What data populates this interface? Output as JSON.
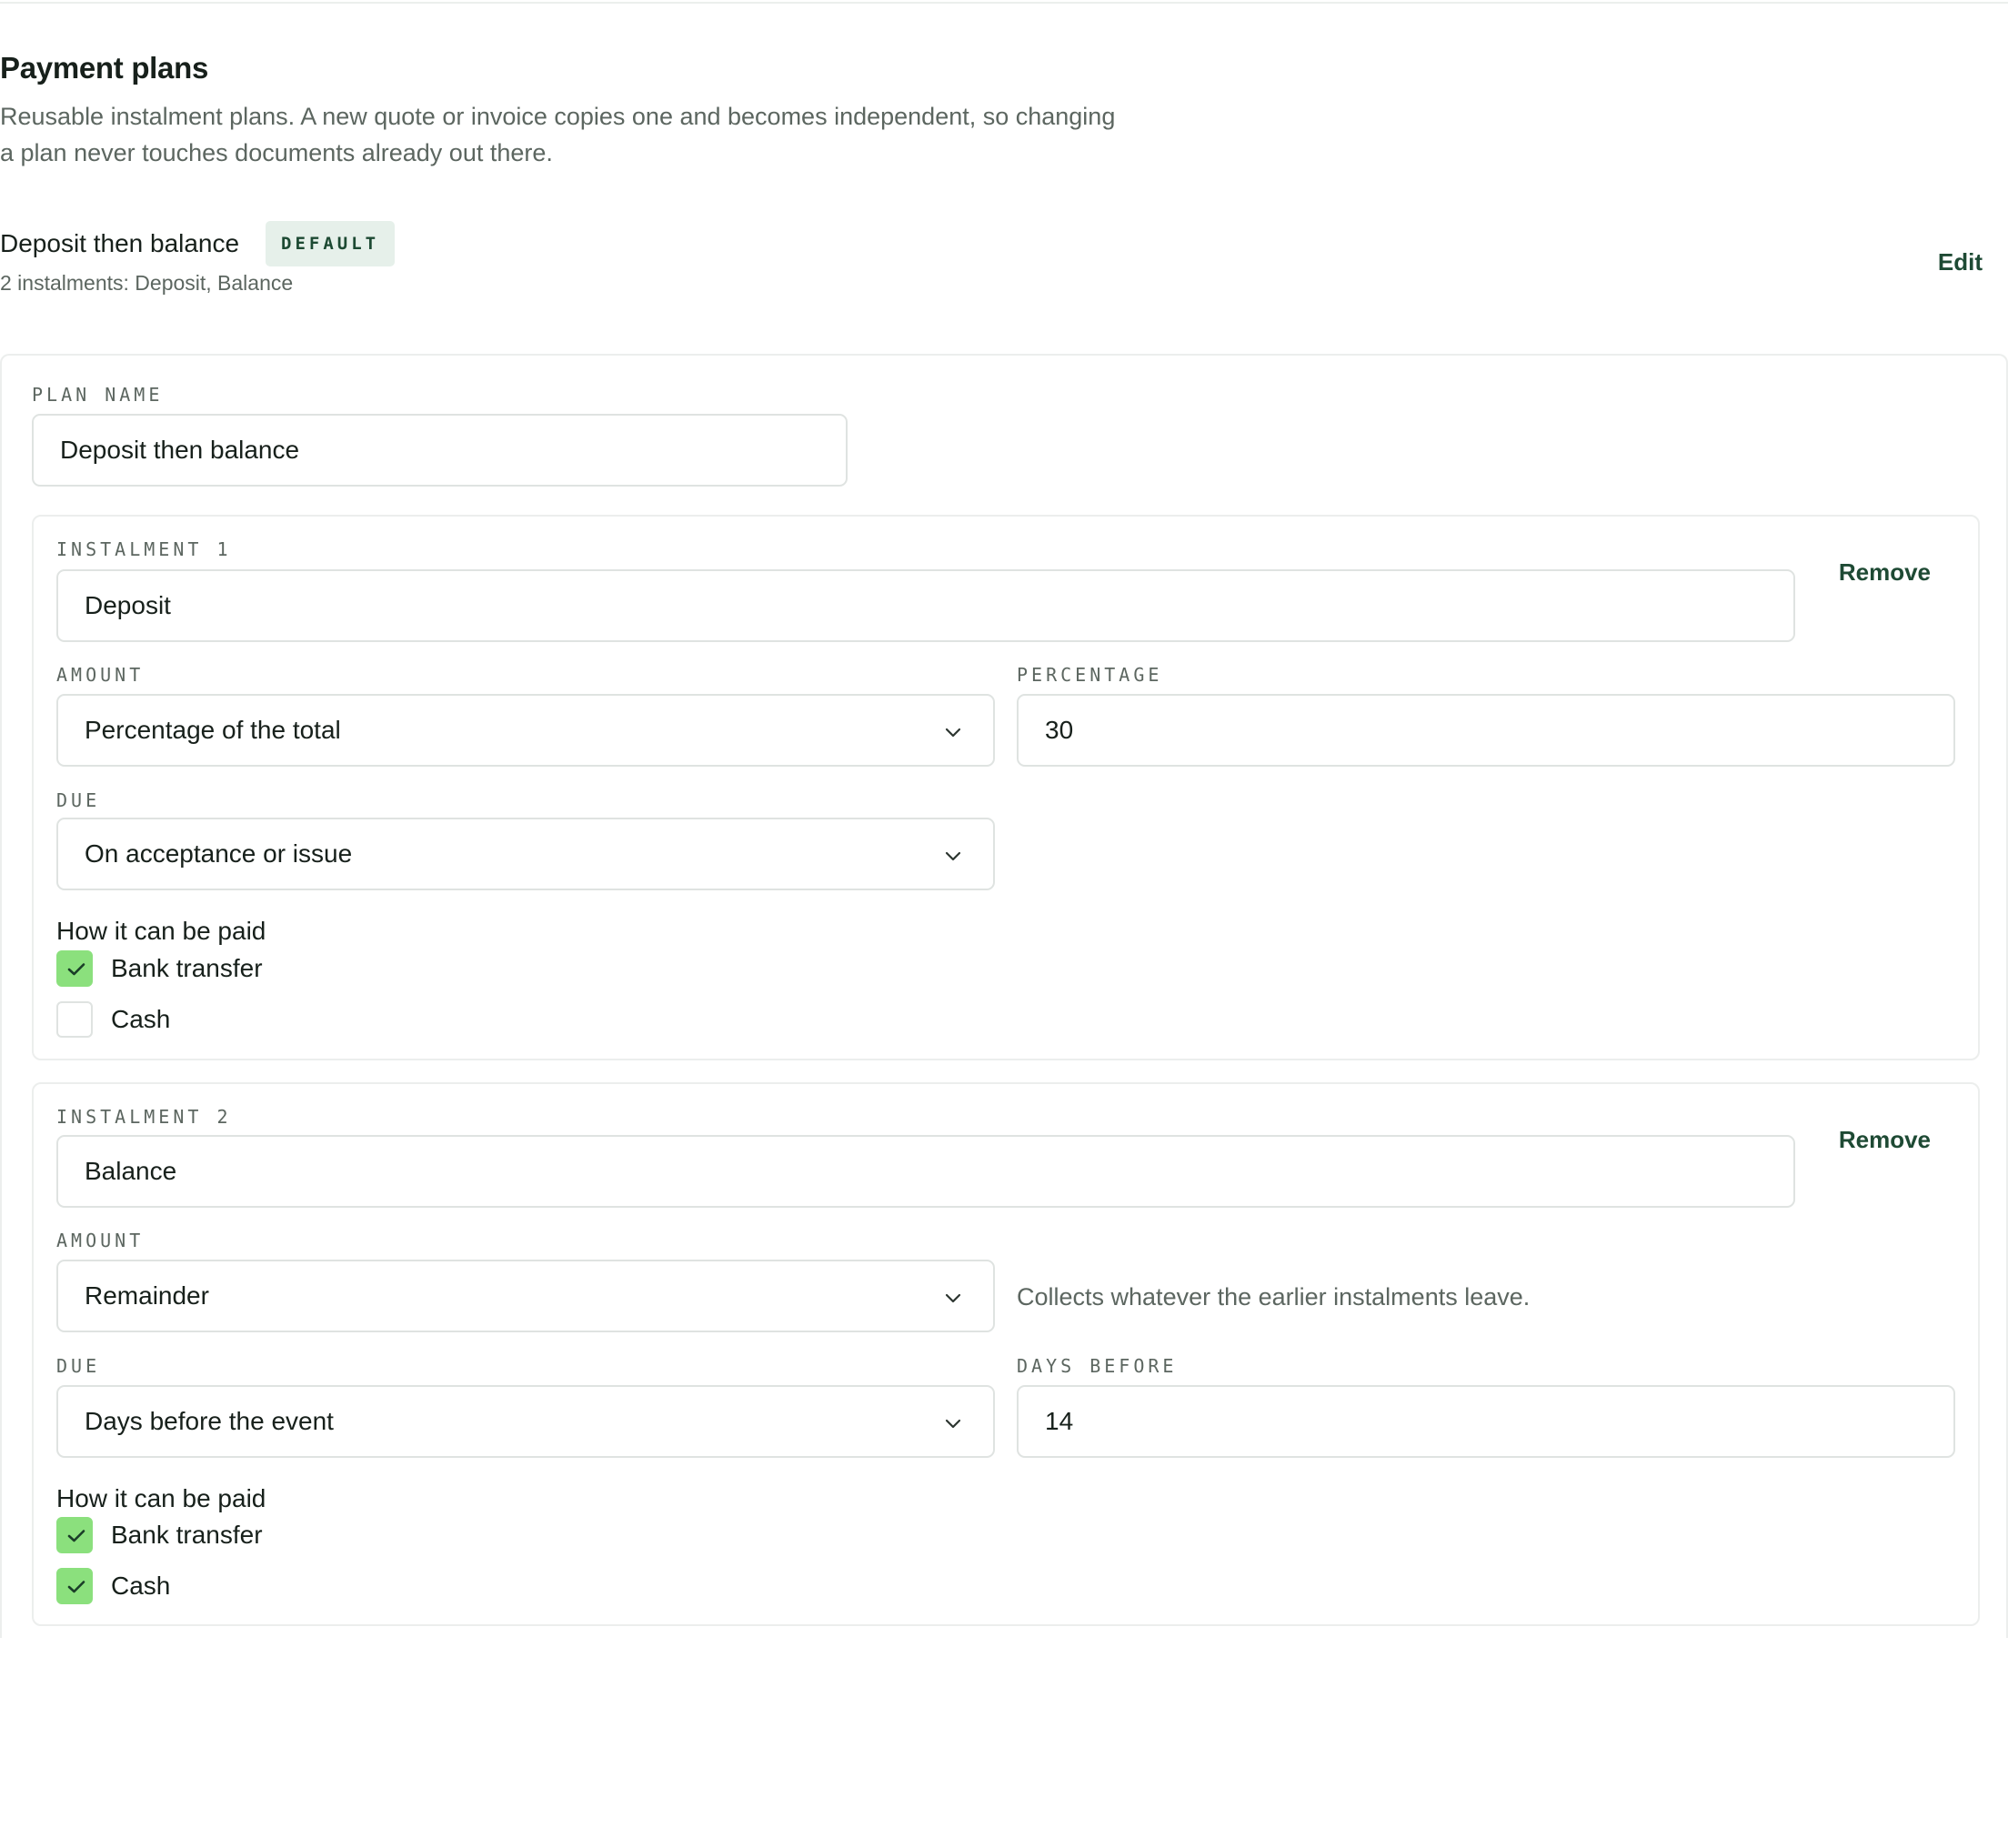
{
  "section": {
    "title": "Payment plans",
    "description": "Reusable instalment plans. A new quote or invoice copies one and becomes independent, so changing a plan never touches documents already out there."
  },
  "plan": {
    "name": "Deposit then balance",
    "badge": "DEFAULT",
    "summary": "2 instalments: Deposit, Balance",
    "edit_label": "Edit"
  },
  "editor": {
    "plan_name_label": "PLAN NAME",
    "plan_name_value": "Deposit then balance",
    "instalments": [
      {
        "label": "INSTALMENT 1",
        "name": "Deposit",
        "remove_label": "Remove",
        "amount_label": "AMOUNT",
        "amount_value": "Percentage of the total",
        "side_label": "PERCENTAGE",
        "side_value": "30",
        "due_label": "DUE",
        "due_value": "On acceptance or issue",
        "pay_title": "How it can be paid",
        "methods": [
          {
            "label": "Bank transfer",
            "checked": true
          },
          {
            "label": "Cash",
            "checked": false
          }
        ]
      },
      {
        "label": "INSTALMENT 2",
        "name": "Balance",
        "remove_label": "Remove",
        "amount_label": "AMOUNT",
        "amount_value": "Remainder",
        "amount_hint": "Collects whatever the earlier instalments leave.",
        "due_label": "DUE",
        "due_value": "Days before the event",
        "side_label": "DAYS BEFORE",
        "side_value": "14",
        "pay_title": "How it can be paid",
        "methods": [
          {
            "label": "Bank transfer",
            "checked": true
          },
          {
            "label": "Cash",
            "checked": true
          }
        ]
      }
    ]
  },
  "colors": {
    "accent": "#1e4a34",
    "checkbox_on": "#8be07d",
    "badge_bg": "#e6f0ea"
  }
}
